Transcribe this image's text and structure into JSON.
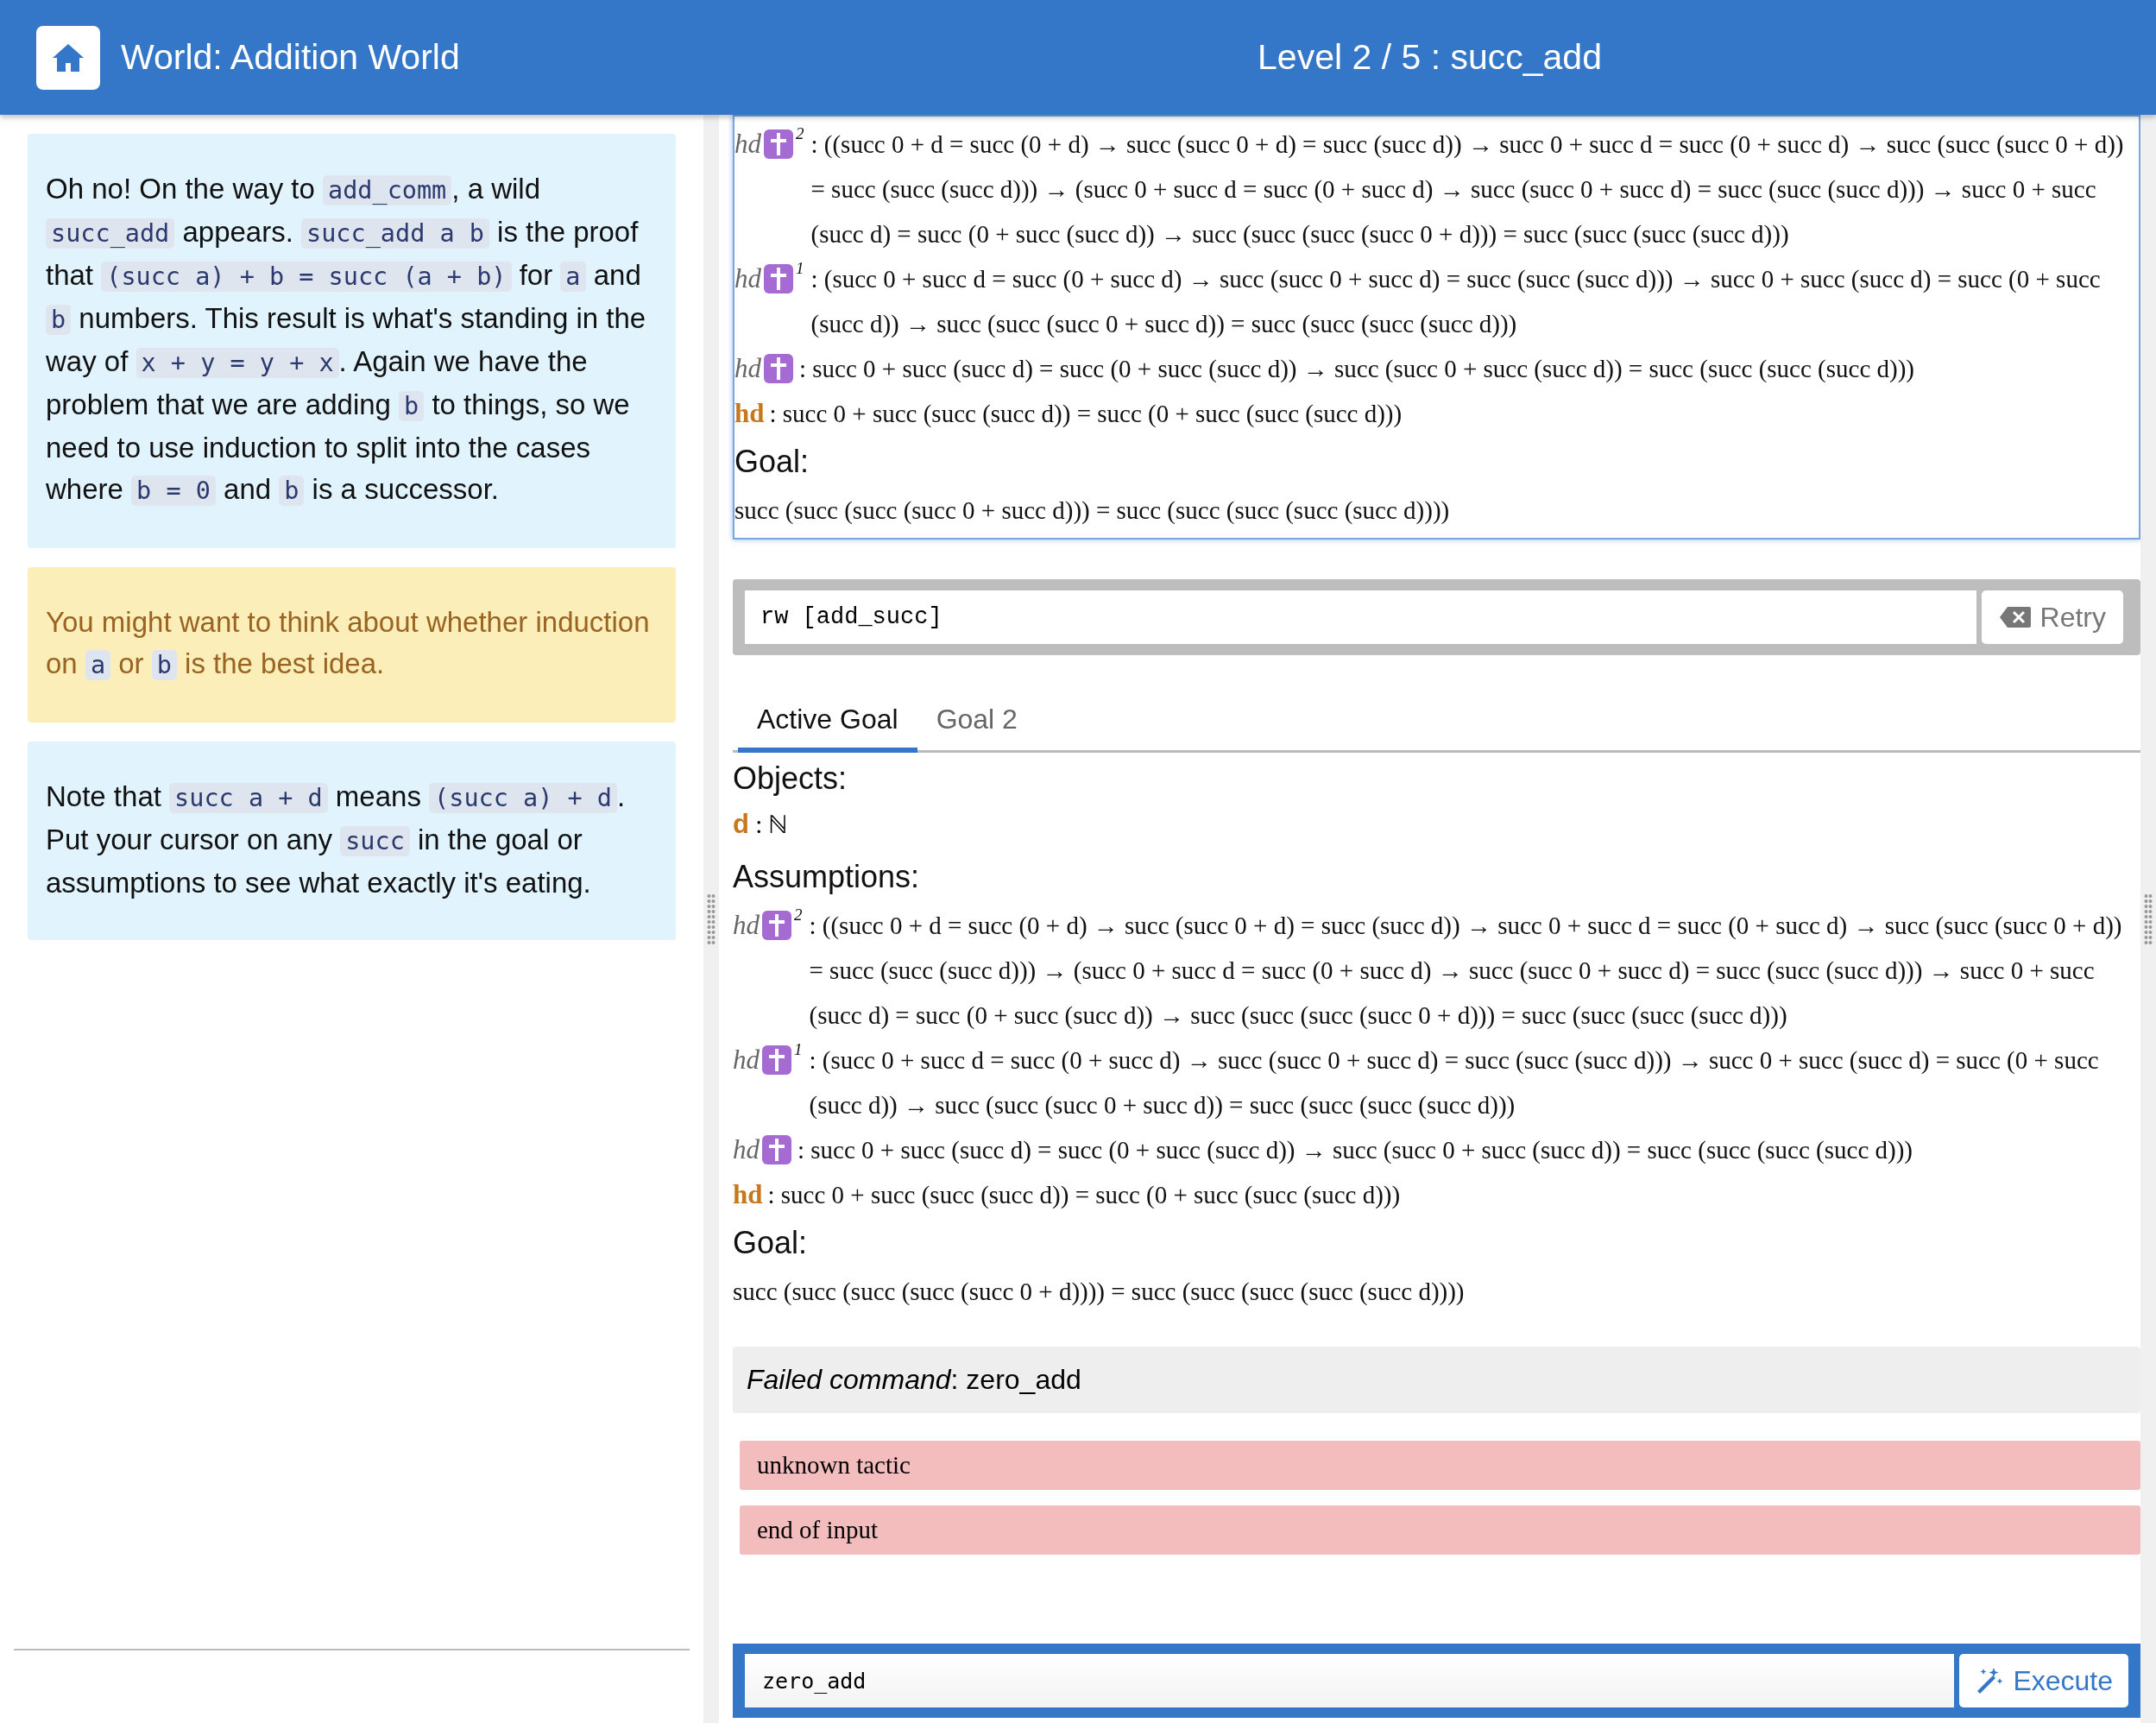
{
  "header": {
    "world_title": "World: Addition World",
    "level_title": "Level 2 / 5 : succ_add"
  },
  "hints": [
    {
      "kind": "info",
      "parts": [
        {
          "kind": "text",
          "text": "Oh no! On the way to "
        },
        {
          "kind": "code",
          "text": "add_comm"
        },
        {
          "kind": "text",
          "text": ", a wild "
        },
        {
          "kind": "code",
          "text": "succ_add"
        },
        {
          "kind": "text",
          "text": " appears. "
        },
        {
          "kind": "code",
          "text": "succ_add a b"
        },
        {
          "kind": "text",
          "text": " is the proof that "
        },
        {
          "kind": "code",
          "text": "(succ a) + b = succ (a + b)"
        },
        {
          "kind": "text",
          "text": " for "
        },
        {
          "kind": "code",
          "text": "a"
        },
        {
          "kind": "text",
          "text": " and "
        },
        {
          "kind": "code",
          "text": "b"
        },
        {
          "kind": "text",
          "text": " numbers. This result is what's standing in the way of "
        },
        {
          "kind": "code",
          "text": "x + y = y + x"
        },
        {
          "kind": "text",
          "text": ". Again we have the problem that we are adding "
        },
        {
          "kind": "code",
          "text": "b"
        },
        {
          "kind": "text",
          "text": " to things, so we need to use induction to split into the cases where "
        },
        {
          "kind": "code",
          "text": "b = 0"
        },
        {
          "kind": "text",
          "text": " and "
        },
        {
          "kind": "code",
          "text": "b"
        },
        {
          "kind": "text",
          "text": " is a successor."
        }
      ]
    },
    {
      "kind": "warning",
      "parts": [
        {
          "kind": "text",
          "text": "You might want to think about whether induction on "
        },
        {
          "kind": "code",
          "text": "a"
        },
        {
          "kind": "text",
          "text": " or "
        },
        {
          "kind": "code",
          "text": "b"
        },
        {
          "kind": "text",
          "text": " is the best idea."
        }
      ]
    },
    {
      "kind": "info",
      "parts": [
        {
          "kind": "text",
          "text": "Note that "
        },
        {
          "kind": "code",
          "text": "succ a + d"
        },
        {
          "kind": "text",
          "text": " means "
        },
        {
          "kind": "code",
          "text": "(succ a) + d"
        },
        {
          "kind": "text",
          "text": ". Put your cursor on any "
        },
        {
          "kind": "code",
          "text": "succ"
        },
        {
          "kind": "text",
          "text": " in the goal or assumptions to see what exactly it's eating."
        }
      ]
    }
  ],
  "previous_step": {
    "assumptions": [
      {
        "name": "hd",
        "shadowed": true,
        "index": "2",
        "statement": ": ((succ 0 + d = succ (0 + d) → succ (succ 0 + d) = succ (succ d)) → succ 0 + succ d = succ (0 + succ d) → succ (succ (succ 0 + d)) = succ (succ (succ d))) → (succ 0 + succ d = succ (0 + succ d) → succ (succ 0 + succ d) = succ (succ (succ d))) → succ 0 + succ (succ d) = succ (0 + succ (succ d)) → succ (succ (succ (succ 0 + d))) = succ (succ (succ (succ d)))"
      },
      {
        "name": "hd",
        "shadowed": true,
        "index": "1",
        "statement": ": (succ 0 + succ d = succ (0 + succ d) → succ (succ 0 + succ d) = succ (succ (succ d))) → succ 0 + succ (succ d) = succ (0 + succ (succ d)) → succ (succ (succ 0 + succ d)) = succ (succ (succ (succ d)))"
      },
      {
        "name": "hd",
        "shadowed": true,
        "statement": ": succ 0 + succ (succ d) = succ (0 + succ (succ d)) → succ (succ 0 + succ (succ d)) = succ (succ (succ (succ d)))"
      },
      {
        "name": "hd",
        "shadowed": false,
        "statement": ": succ 0 + succ (succ (succ d)) = succ (0 + succ (succ (succ d)))"
      }
    ],
    "goal_heading": "Goal:",
    "goal": "succ (succ (succ (succ 0 + succ d))) = succ (succ (succ (succ (succ d))))"
  },
  "command": {
    "text": "rw [add_succ]",
    "button": "Retry"
  },
  "tabs": [
    {
      "label": "Active Goal",
      "selected": true
    },
    {
      "label": "Goal 2",
      "selected": false
    }
  ],
  "objects_heading": "Objects:",
  "objects": [
    {
      "name": "d",
      "type": ": ℕ"
    }
  ],
  "assumptions_heading": "Assumptions:",
  "assumptions": [
    {
      "name": "hd",
      "shadowed": true,
      "index": "2",
      "statement": ": ((succ 0 + d = succ (0 + d) → succ (succ 0 + d) = succ (succ d)) → succ 0 + succ d = succ (0 + succ d) → succ (succ (succ 0 + d)) = succ (succ (succ d))) → (succ 0 + succ d = succ (0 + succ d) → succ (succ 0 + succ d) = succ (succ (succ d))) → succ 0 + succ (succ d) = succ (0 + succ (succ d)) → succ (succ (succ (succ 0 + d))) = succ (succ (succ (succ d)))"
    },
    {
      "name": "hd",
      "shadowed": true,
      "index": "1",
      "statement": ": (succ 0 + succ d = succ (0 + succ d) → succ (succ 0 + succ d) = succ (succ (succ d))) → succ 0 + succ (succ d) = succ (0 + succ (succ d)) → succ (succ (succ 0 + succ d)) = succ (succ (succ (succ d)))"
    },
    {
      "name": "hd",
      "shadowed": true,
      "statement": ": succ 0 + succ (succ d) = succ (0 + succ (succ d)) → succ (succ 0 + succ (succ d)) = succ (succ (succ (succ d)))"
    },
    {
      "name": "hd",
      "shadowed": false,
      "statement": ": succ 0 + succ (succ (succ d)) = succ (0 + succ (succ (succ d)))"
    }
  ],
  "goal_heading": "Goal:",
  "goal": "succ (succ (succ (succ (succ 0 + d)))) = succ (succ (succ (succ (succ d))))",
  "failed_command": "*Failed command*: zero_add",
  "errors": [
    "unknown tactic",
    "end of input"
  ],
  "input": {
    "value": "zero_add",
    "button": "Execute"
  }
}
